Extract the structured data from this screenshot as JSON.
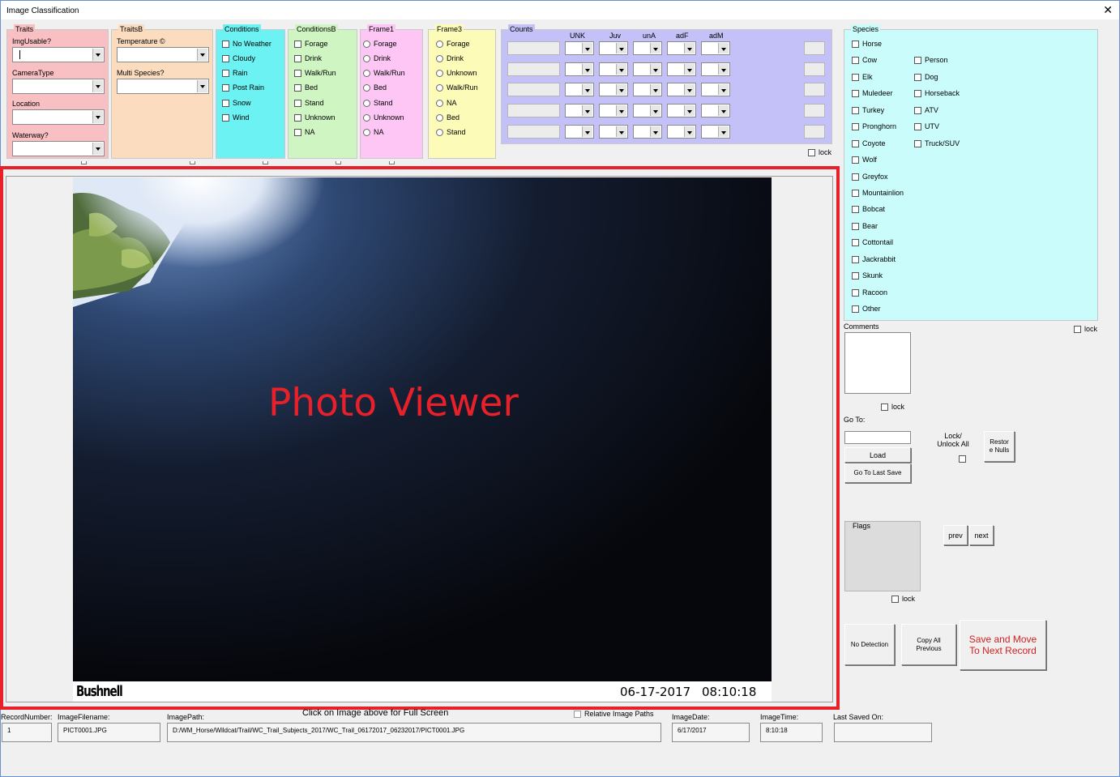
{
  "window": {
    "title": "Image Classification",
    "close_glyph": "✕"
  },
  "traits": {
    "legend": "Traits",
    "img_usable_label": "ImgUsable?",
    "camera_type_label": "CameraType",
    "location_label": "Location",
    "waterway_label": "Waterway?"
  },
  "traitsB": {
    "legend": "TraitsB",
    "temperature_label": "Temperature ©",
    "multi_species_label": "Multi Species?"
  },
  "conditions": {
    "legend": "Conditions",
    "items": [
      "No Weather",
      "Cloudy",
      "Rain",
      "Post Rain",
      "Snow",
      "Wind"
    ]
  },
  "conditionsB": {
    "legend": "ConditionsB",
    "items": [
      "Forage",
      "Drink",
      "Walk/Run",
      "Bed",
      "Stand",
      "Unknown",
      "NA"
    ]
  },
  "frame1": {
    "legend": "Frame1",
    "items": [
      "Forage",
      "Drink",
      "Walk/Run",
      "Bed",
      "Stand",
      "Unknown",
      "NA"
    ]
  },
  "frame3": {
    "legend": "Frame3",
    "items": [
      "Forage",
      "Drink",
      "Unknown",
      "Walk/Run",
      "NA",
      "Bed",
      "Stand"
    ]
  },
  "counts": {
    "legend": "Counts",
    "columns": [
      "UNK",
      "Juv",
      "unA",
      "adF",
      "adM"
    ],
    "lock_label": "lock"
  },
  "species": {
    "legend": "Species",
    "col1": [
      "Horse",
      "Cow",
      "Elk",
      "Muledeer",
      "Turkey",
      "Pronghorn",
      "Coyote",
      "Wolf",
      "Greyfox",
      "Mountainlion",
      "Bobcat",
      "Bear",
      "Cottontail",
      "Jackrabbit",
      "Skunk",
      "Racoon",
      "Other"
    ],
    "col2": [
      "Person",
      "Dog",
      "Horseback",
      "ATV",
      "UTV",
      "Truck/SUV"
    ],
    "lock_label": "lock"
  },
  "photo": {
    "overlay_label": "Photo Viewer",
    "brand": "Bushnell",
    "date_stamp": "06-17-2017",
    "time_stamp": "08:10:18",
    "hint": "Click on Image above for Full Screen",
    "accent_color": "#e8202a"
  },
  "comments": {
    "label": "Comments",
    "lock_label": "lock"
  },
  "goto": {
    "label": "Go To:",
    "load_button": "Load",
    "last_save_button": "Go To Last Save",
    "lock_unlock_label": "Lock/ Unlock All",
    "restore_nulls_button": "Restor e Nulls"
  },
  "flags": {
    "label": "Flags",
    "lock_label": "lock"
  },
  "nav": {
    "prev": "prev",
    "next": "next"
  },
  "actions": {
    "no_detection": "No Detection",
    "copy_all_previous": "Copy All Previous",
    "save_and_move": "Save and Move To Next Record",
    "save_color": "#d42020"
  },
  "footer": {
    "record_number_label": "RecordNumber:",
    "record_number": "1",
    "image_filename_label": "ImageFilename:",
    "image_filename": "PICT0001.JPG",
    "image_path_label": "ImagePath:",
    "image_path": "D:/WM_Horse/Wildcat/Trail/WC_Trail_Subjects_2017/WC_Trail_06172017_06232017/PICT0001.JPG",
    "relative_paths_label": "Relative Image Paths",
    "image_date_label": "ImageDate:",
    "image_date": "6/17/2017",
    "image_time_label": "ImageTime:",
    "image_time": "8:10:18",
    "last_saved_label": "Last Saved On:",
    "last_saved": ""
  },
  "colors": {
    "traits": "#f9c0c3",
    "traitsB": "#fcdcbf",
    "conditions": "#6cf2f2",
    "conditionsB": "#cef5c2",
    "frame1": "#fdc6f5",
    "frame3": "#fdfbb8",
    "counts": "#c3c1f7",
    "species": "#c9fcfa",
    "highlight": "#e8202a"
  }
}
